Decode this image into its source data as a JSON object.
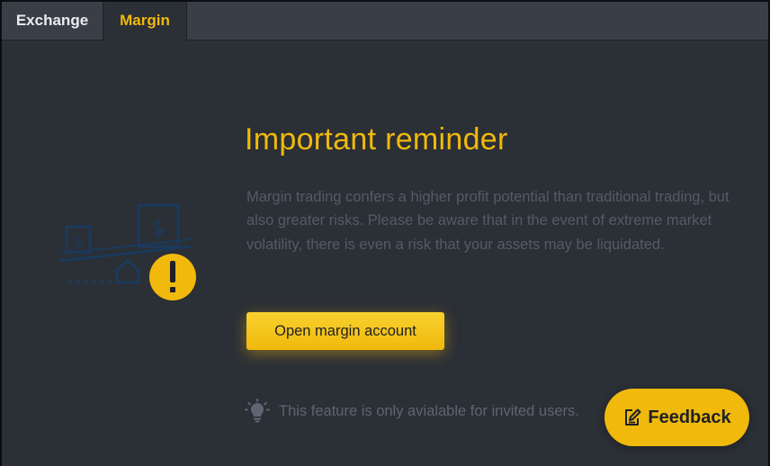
{
  "tabs": [
    {
      "label": "Exchange",
      "active": false
    },
    {
      "label": "Margin",
      "active": true
    }
  ],
  "reminder": {
    "title": "Important reminder",
    "description": "Margin trading confers a higher profit potential than traditional trading, but also greater risks. Please be aware that in the event of extreme market volatility, there is even a risk that your assets may be liquidated.",
    "button_label": "Open margin account",
    "note": "This feature is only avialable for invited users."
  },
  "feedback": {
    "label": "Feedback"
  },
  "icons": {
    "illustration": "scale-with-warning-icon",
    "note": "lightbulb-icon",
    "feedback": "edit-note-icon"
  },
  "colors": {
    "accent": "#f0b90b",
    "background": "#2b2f36",
    "tab_bar": "#3a3f47"
  }
}
